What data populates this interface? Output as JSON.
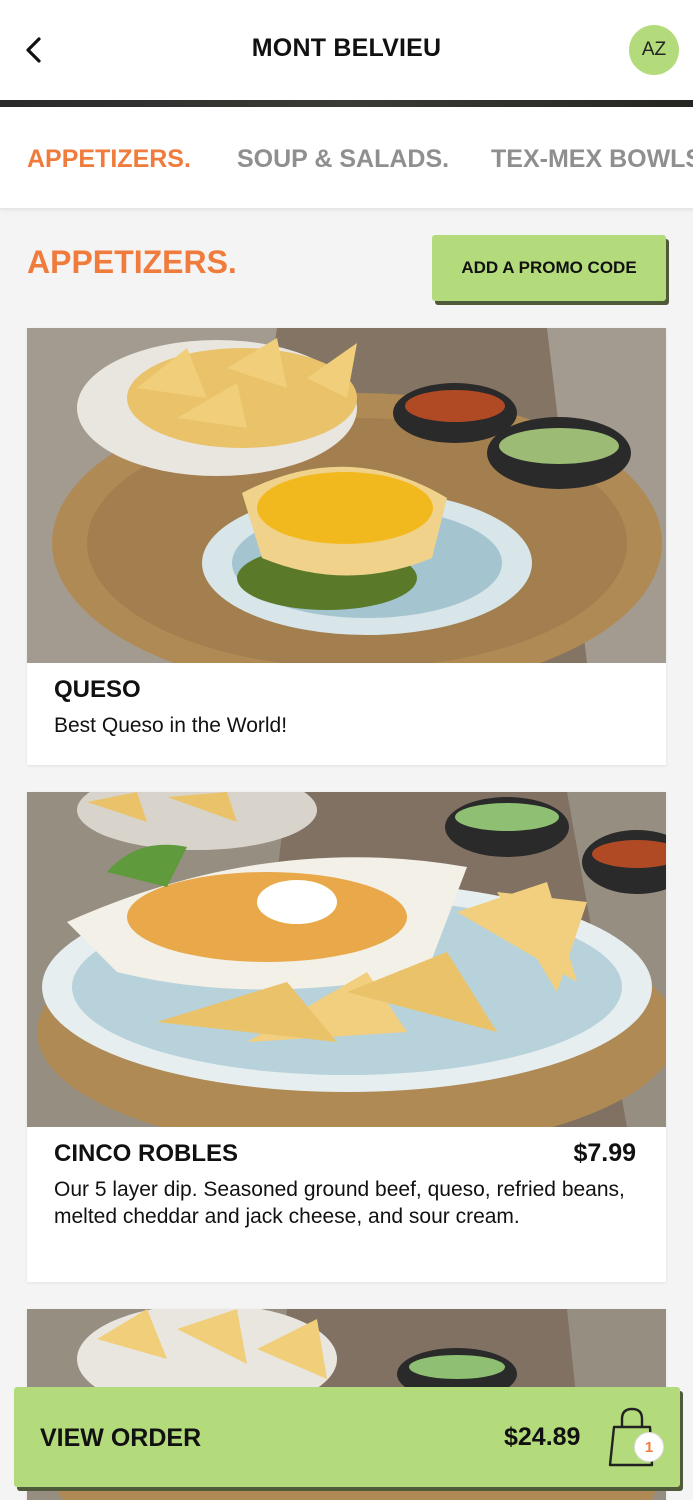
{
  "header": {
    "title": "MONT BELVIEU",
    "avatar_initials": "AZ",
    "back_icon": "chevron-left-icon"
  },
  "tabs": [
    {
      "label": "APPETIZERS.",
      "active": true
    },
    {
      "label": "SOUP & SALADS.",
      "active": false
    },
    {
      "label": "TEX-MEX BOWLS",
      "active": false
    }
  ],
  "section": {
    "title": "APPETIZERS.",
    "promo_label": "ADD A PROMO CODE"
  },
  "items": [
    {
      "name": "QUESO",
      "price": "",
      "description": "Best Queso in the World!"
    },
    {
      "name": "CINCO ROBLES",
      "price": "$7.99",
      "description": "Our 5 layer dip. Seasoned ground beef, queso, refried beans, melted cheddar and jack cheese, and sour cream."
    }
  ],
  "order": {
    "label": "VIEW ORDER",
    "total": "$24.89",
    "count": "1",
    "bag_icon": "shopping-bag-icon"
  },
  "colors": {
    "accent_orange": "#ef7c3c",
    "accent_green": "#b4db7b",
    "text": "#111111",
    "inactive_tab": "#8f8f8f"
  }
}
